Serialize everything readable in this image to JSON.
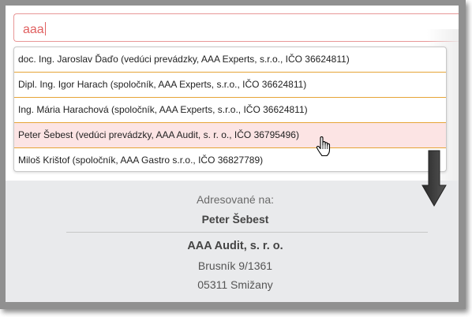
{
  "search": {
    "value": "aaa"
  },
  "dropdown": {
    "items": [
      {
        "label": "doc. Ing. Jaroslav Ďaďo (vedúci prevádzky, AAA Experts, s.r.o., IČO 36624811)"
      },
      {
        "label": "Dipl. Ing. Igor Harach (spoločník, AAA Experts, s.r.o., IČO 36624811)"
      },
      {
        "label": "Ing. Mária Harachová (spoločník, AAA Experts, s.r.o., IČO 36624811)"
      },
      {
        "label": "Peter Šebest (vedúci prevádzky, AAA Audit, s. r. o., IČO 36795496)"
      },
      {
        "label": "Miloš Krištof (spoločník, AAA Gastro s.r.o., IČO 36827789)"
      }
    ],
    "highlighted_index": 3
  },
  "address": {
    "label": "Adresované na:",
    "name": "Peter Šebest",
    "company": "AAA Audit, s. r. o.",
    "street": "Brusník 9/1361",
    "city": "05311 Smižany"
  },
  "colors": {
    "frame": "#909090",
    "input_border": "#e89797",
    "input_text": "#e06060",
    "item_separator": "#e6a437",
    "highlight": "#fce4e4",
    "panel_bg": "#e9eaec"
  },
  "icons": {
    "cursor": "hand-pointer-icon",
    "annotation": "down-arrow-icon"
  }
}
